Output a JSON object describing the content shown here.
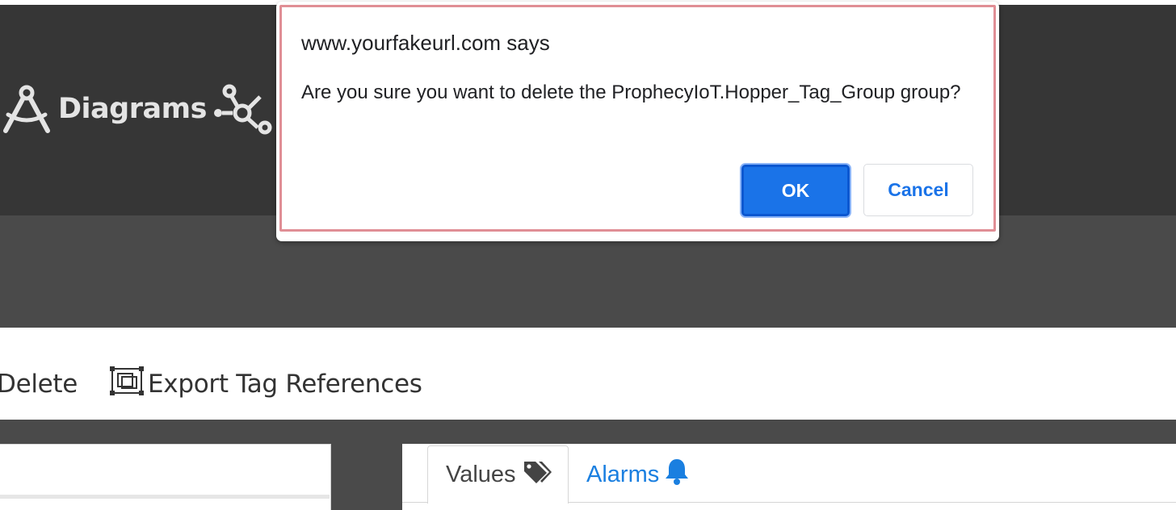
{
  "nav": {
    "diagrams_label": "Diagrams"
  },
  "toolbar": {
    "delete_label": "Delete",
    "export_label": "Export Tag References"
  },
  "tabs": [
    {
      "label": "Values",
      "icon": "tags-icon",
      "active": true
    },
    {
      "label": "Alarms",
      "icon": "bell-icon",
      "active": false
    }
  ],
  "dialog": {
    "title": "www.yourfakeurl.com says",
    "message": "Are you sure you want to delete the ProphecyIoT.Hopper_Tag_Group group?",
    "ok_label": "OK",
    "cancel_label": "Cancel"
  },
  "colors": {
    "topbar": "#363636",
    "background": "#4a4a4a",
    "link": "#1a7fe0",
    "ok_button": "#1a73e8",
    "dialog_frame": "#e08e95"
  }
}
